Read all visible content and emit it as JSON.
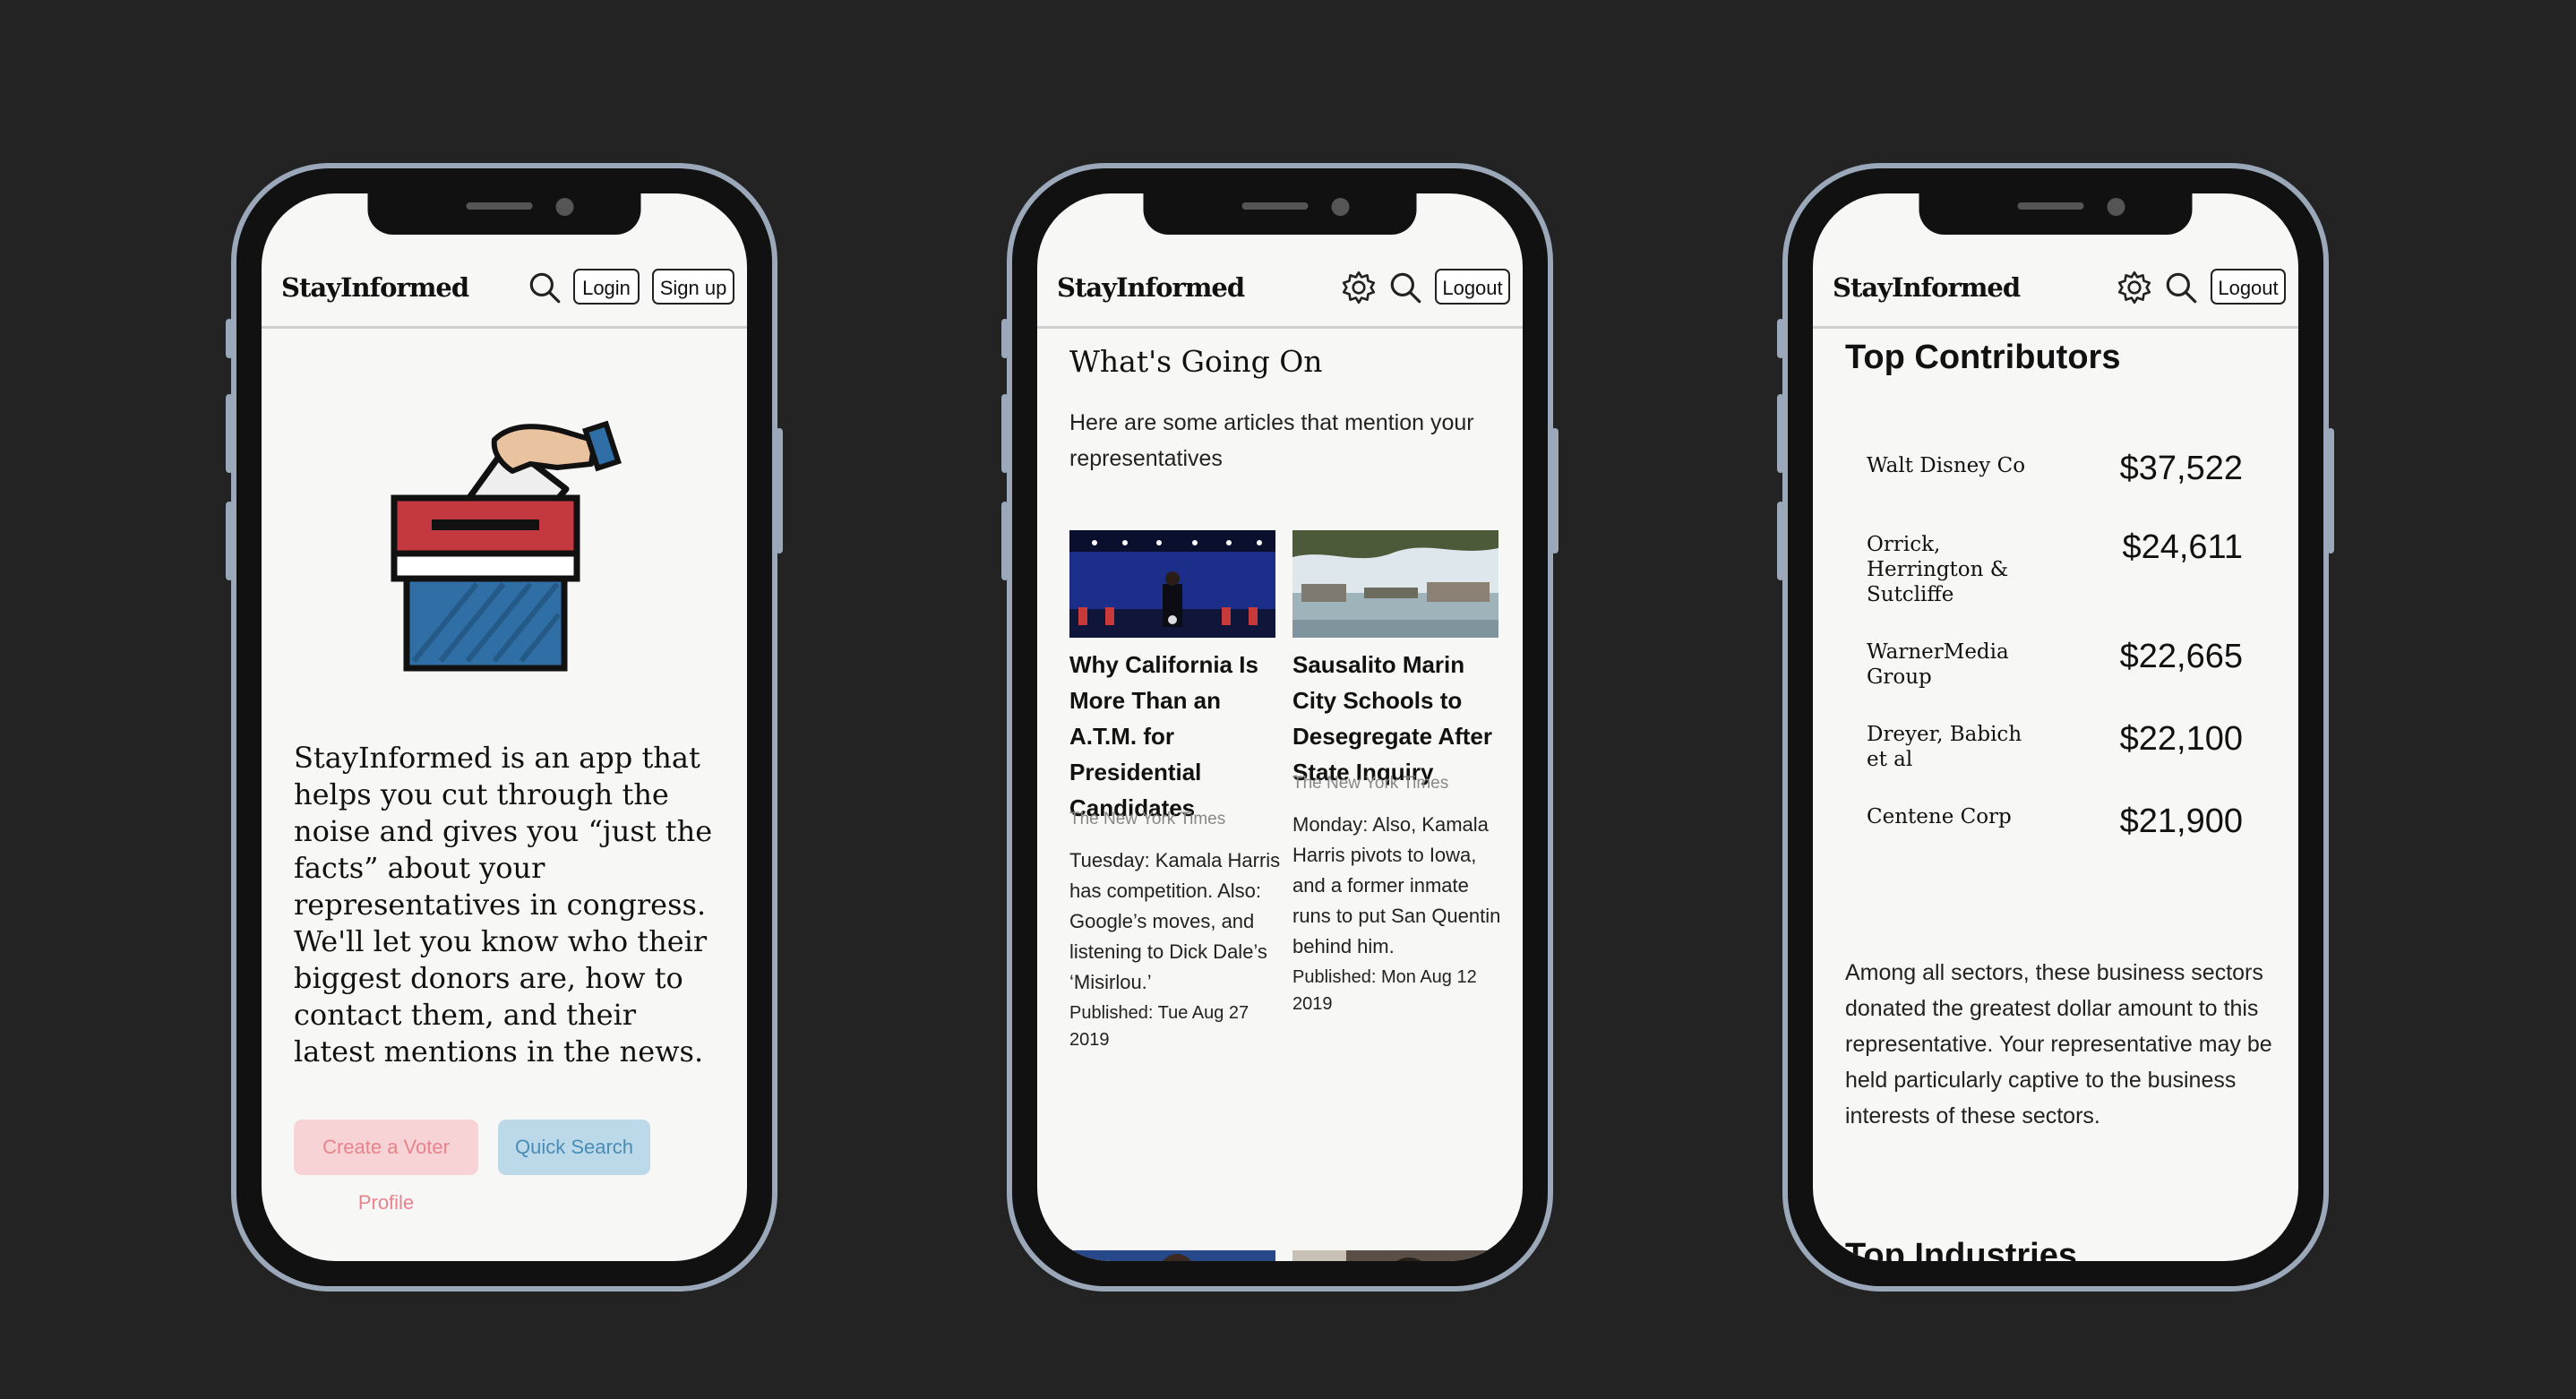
{
  "app": {
    "logo": "StayInformed"
  },
  "phone1": {
    "login": "Login",
    "signup": "Sign up",
    "intro": "StayInformed is an app that helps you cut through the noise and gives you “just the facts” about your representatives in congress. We'll let you know who their biggest donors are, how to contact them, and their latest mentions in the news.",
    "create_profile": "Create a Voter Profile",
    "quick_search": "Quick Search"
  },
  "phone2": {
    "logout": "Logout",
    "heading": "What's Going On",
    "subheading": "Here are some articles that mention your representatives",
    "articles": [
      {
        "title": "Why California Is More Than an A.T.M. for Presidential Candidates",
        "source": "The New York Times",
        "summary": "Tuesday: Kamala Harris has competition. Also: Google’s moves, and listening to Dick Dale’s ‘Misirlou.’",
        "published": "Published: Tue Aug 27 2019"
      },
      {
        "title": "Sausalito Marin City Schools to Desegregate After State Inquiry",
        "source": "The New York Times",
        "summary": "Monday: Also, Kamala Harris pivots to Iowa, and a former inmate runs to put San Quentin behind him.",
        "published": "Published: Mon Aug 12 2019"
      }
    ]
  },
  "phone3": {
    "logout": "Logout",
    "heading": "Top Contributors",
    "contributors": [
      {
        "name": "Walt Disney Co",
        "amount": "$37,522"
      },
      {
        "name": "Orrick, Herrington & Sutcliffe",
        "amount": "$24,611"
      },
      {
        "name": "WarnerMedia Group",
        "amount": "$22,665"
      },
      {
        "name": "Dreyer, Babich et al",
        "amount": "$22,100"
      },
      {
        "name": "Centene Corp",
        "amount": "$21,900"
      }
    ],
    "sector_text": "Among all sectors, these business sectors donated the greatest dollar amount to this representative. Your representative may be held particularly captive to the business interests of these sectors.",
    "industries_heading": "Top Industries"
  },
  "colors": {
    "background": "#232323",
    "frame": "#9aa8ba",
    "create_btn_bg": "#f7d3d6",
    "create_btn_text": "#e8838c",
    "quick_btn_bg": "#bcd9ea",
    "quick_btn_text": "#4a8cb5"
  }
}
